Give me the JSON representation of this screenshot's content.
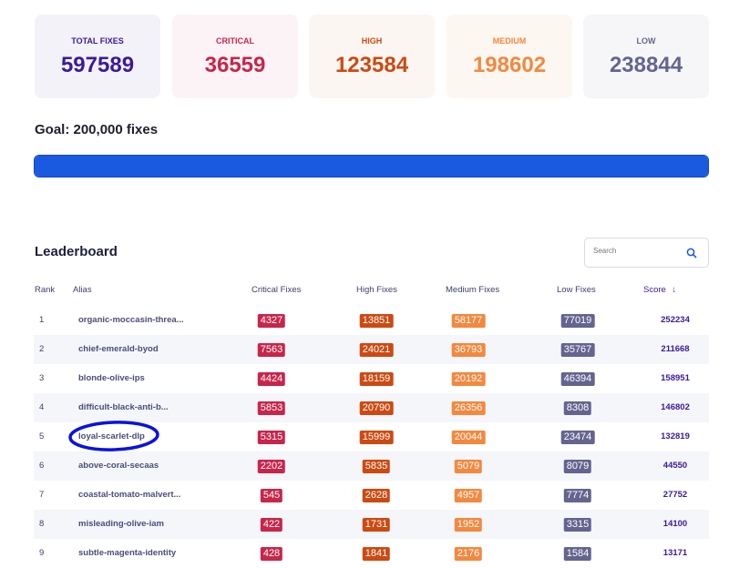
{
  "stats": [
    {
      "label": "TOTAL FIXES",
      "value": "597589",
      "bg": "#f3f2f9",
      "color": "#3a1a9a"
    },
    {
      "label": "CRITICAL",
      "value": "36559",
      "bg": "#fcf3f6",
      "color": "#c8254a"
    },
    {
      "label": "HIGH",
      "value": "123584",
      "bg": "#fbf6f2",
      "color": "#cc4a12"
    },
    {
      "label": "MEDIUM",
      "value": "198602",
      "bg": "#fdf7f2",
      "color": "#f3883f"
    },
    {
      "label": "LOW",
      "value": "238844",
      "bg": "#f6f6f9",
      "color": "#65648f"
    }
  ],
  "goal": {
    "label": "Goal: 200,000 fixes",
    "progress_percent": 100,
    "color": "#1a5ae0"
  },
  "leaderboard": {
    "title": "Leaderboard",
    "search_placeholder": "Search",
    "columns": [
      "Rank",
      "Alias",
      "Critical Fixes",
      "High Fixes",
      "Medium Fixes",
      "Low Fixes",
      "Score"
    ],
    "sort": {
      "column": "Score",
      "direction": "desc"
    },
    "rows": [
      {
        "rank": "1",
        "alias": "organic-moccasin-threa...",
        "critical": "4327",
        "high": "13851",
        "medium": "58177",
        "low": "77019",
        "score": "252234"
      },
      {
        "rank": "2",
        "alias": "chief-emerald-byod",
        "critical": "7563",
        "high": "24021",
        "medium": "36793",
        "low": "35767",
        "score": "211668"
      },
      {
        "rank": "3",
        "alias": "blonde-olive-ips",
        "critical": "4424",
        "high": "18159",
        "medium": "20192",
        "low": "46394",
        "score": "158951"
      },
      {
        "rank": "4",
        "alias": "difficult-black-anti-b...",
        "critical": "5853",
        "high": "20790",
        "medium": "26356",
        "low": "8308",
        "score": "146802"
      },
      {
        "rank": "5",
        "alias": "loyal-scarlet-dlp",
        "critical": "5315",
        "high": "15999",
        "medium": "20044",
        "low": "23474",
        "score": "132819",
        "highlighted": true
      },
      {
        "rank": "6",
        "alias": "above-coral-secaas",
        "critical": "2202",
        "high": "5835",
        "medium": "5079",
        "low": "8079",
        "score": "44550"
      },
      {
        "rank": "7",
        "alias": "coastal-tomato-malvert...",
        "critical": "545",
        "high": "2628",
        "medium": "4957",
        "low": "7774",
        "score": "27752"
      },
      {
        "rank": "8",
        "alias": "misleading-olive-iam",
        "critical": "422",
        "high": "1731",
        "medium": "1952",
        "low": "3315",
        "score": "14100"
      },
      {
        "rank": "9",
        "alias": "subtle-magenta-identity",
        "critical": "428",
        "high": "1841",
        "medium": "2176",
        "low": "1584",
        "score": "13171"
      }
    ]
  }
}
